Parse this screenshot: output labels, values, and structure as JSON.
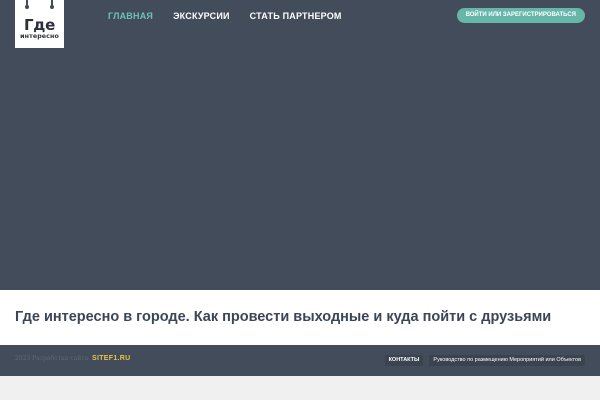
{
  "logo": {
    "line1": "Где",
    "line2": "интересно"
  },
  "nav": [
    {
      "label": "Главная",
      "active": true
    },
    {
      "label": "Экскурсии",
      "active": false
    },
    {
      "label": "Стать партнером",
      "active": false
    }
  ],
  "login_label": "Войти или зарегистрироваться",
  "headline": "Где интересно в городе. Как провести выходные и куда пойти с друзьями",
  "footer": {
    "copyright": "2023 Разработка сайта",
    "site_logo": "SITEF1.RU",
    "links": [
      {
        "label": "Контакты"
      },
      {
        "label": "Руководство по размещению Мероприятий или Объектов"
      }
    ]
  },
  "colors": {
    "header_bg": "#424c5b",
    "accent": "#6fc1b4",
    "button": "#66b6aa",
    "headline_text": "#3a4658",
    "site_logo": "#e7c447"
  }
}
